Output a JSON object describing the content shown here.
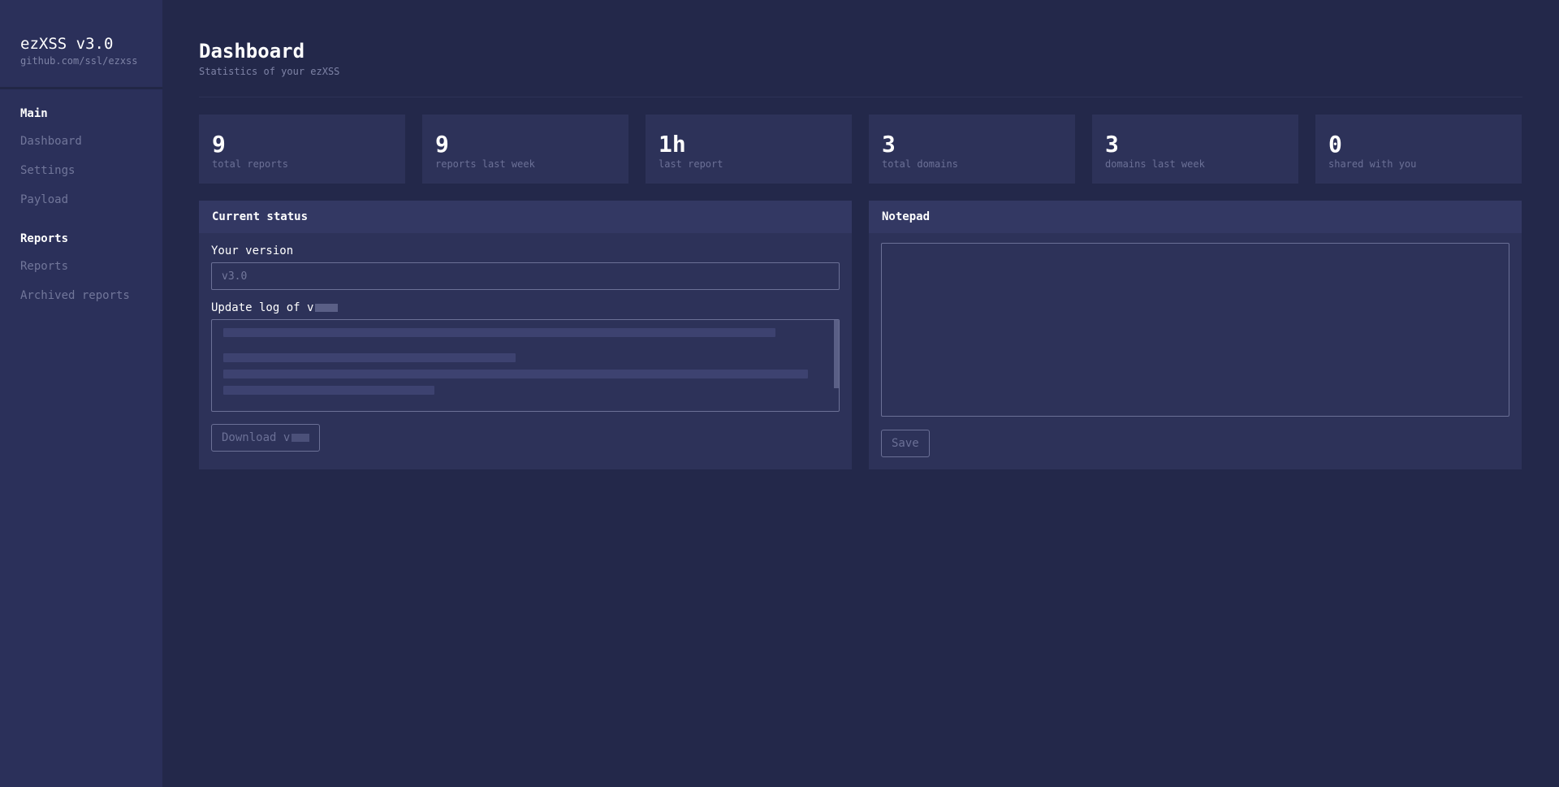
{
  "sidebar": {
    "brand_title": "ezXSS v3.0",
    "brand_sub": "github.com/ssl/ezxss",
    "sections": [
      {
        "heading": "Main",
        "items": [
          "Dashboard",
          "Settings",
          "Payload"
        ]
      },
      {
        "heading": "Reports",
        "items": [
          "Reports",
          "Archived reports"
        ]
      }
    ]
  },
  "header": {
    "title": "Dashboard",
    "subtitle": "Statistics of your ezXSS"
  },
  "stats": [
    {
      "value": "9",
      "label": "total reports"
    },
    {
      "value": "9",
      "label": "reports last week"
    },
    {
      "value": "1h",
      "label": "last report"
    },
    {
      "value": "3",
      "label": "total domains"
    },
    {
      "value": "3",
      "label": "domains last week"
    },
    {
      "value": "0",
      "label": "shared with you"
    }
  ],
  "status_panel": {
    "title": "Current status",
    "version_label": "Your version",
    "version_value": "v3.0",
    "log_label": "Update log of v",
    "download_label": "Download v"
  },
  "notepad_panel": {
    "title": "Notepad",
    "content": "",
    "save_label": "Save"
  }
}
